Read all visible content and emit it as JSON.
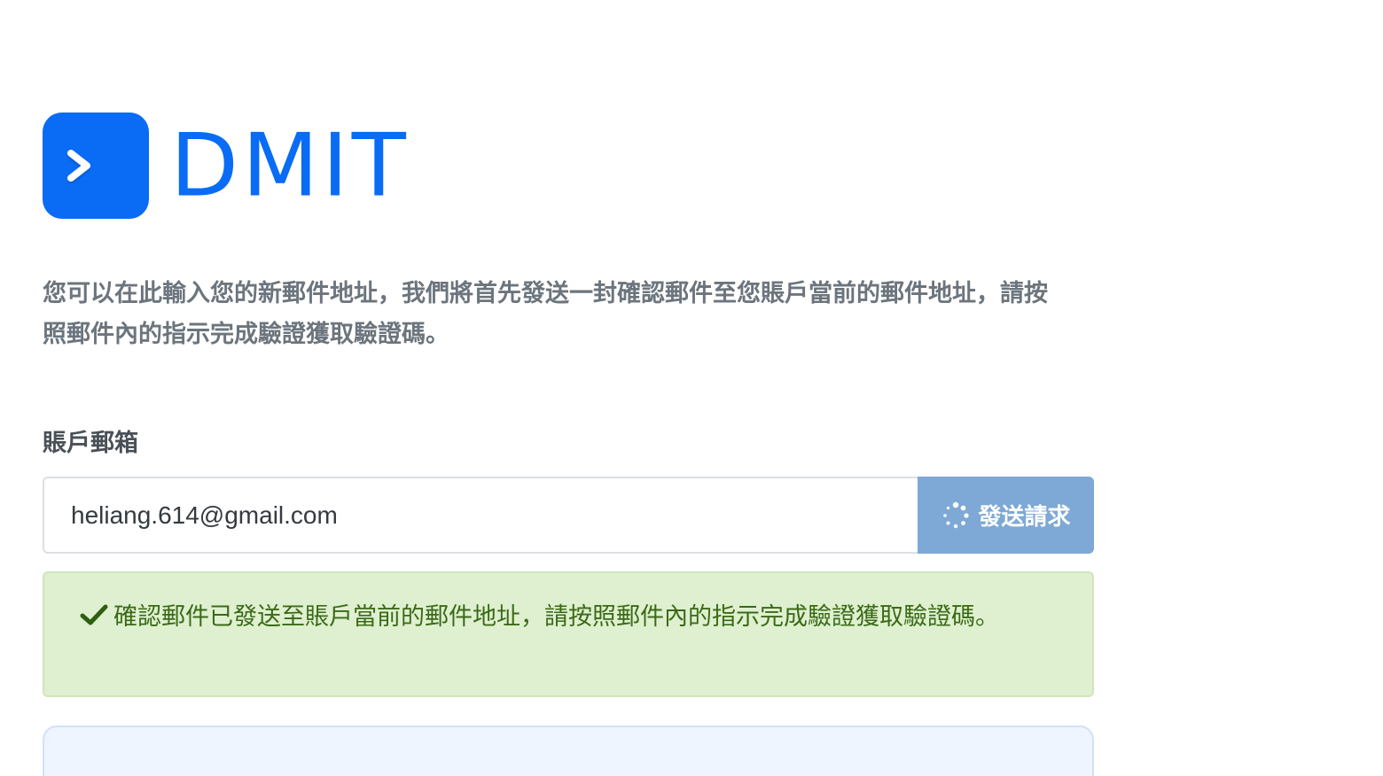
{
  "brand": {
    "name": "DMIT",
    "color": "#0a6cf5"
  },
  "intro_text": "您可以在此輸入您的新郵件地址，我們將首先發送一封確認郵件至您賬戶當前的郵件地址，請按照郵件內的指示完成驗證獲取驗證碼。",
  "form": {
    "email_label": "賬戶郵箱",
    "email_value": "heliang.614@gmail.com",
    "send_button_label": "發送請求",
    "send_button_state": "loading"
  },
  "alert": {
    "type": "success",
    "icon": "check-icon",
    "message": "確認郵件已發送至賬戶當前的郵件地址，請按照郵件內的指示完成驗證獲取驗證碼。"
  },
  "colors": {
    "accent": "#0a6cf5",
    "button_disabled": "#7ea9d6",
    "success_bg": "#dff0d0",
    "success_text": "#3b6a17",
    "info_bg": "#eef5ff"
  }
}
